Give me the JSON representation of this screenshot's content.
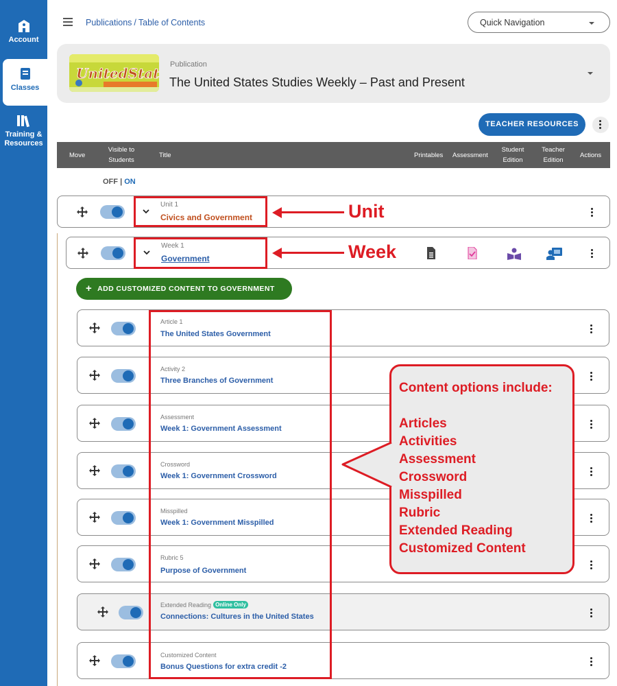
{
  "sidebar": {
    "items": [
      {
        "label": "Account"
      },
      {
        "label": "Classes"
      },
      {
        "label": "Training &",
        "label2": "Resources"
      }
    ]
  },
  "header": {
    "breadcrumb": {
      "root": "Publications",
      "separator": "/",
      "current": "Table of Contents"
    },
    "quick_nav": {
      "label": "Quick Navigation"
    }
  },
  "publication": {
    "label": "Publication",
    "title": "The United States Studies Weekly – Past and Present"
  },
  "teacher_resources_label": "TEACHER RESOURCES",
  "table_header": {
    "move": "Move",
    "visible1": "Visible to",
    "visible2": "Students",
    "title": "Title",
    "printables": "Printables",
    "assessment": "Assessment",
    "student1": "Student",
    "student2": "Edition",
    "teacher1": "Teacher",
    "teacher2": "Edition",
    "actions": "Actions"
  },
  "visibility": {
    "off": "OFF",
    "sep": "|",
    "on": "ON"
  },
  "unit": {
    "label": "Unit 1",
    "title": "Civics and Government",
    "visible": true
  },
  "week": {
    "label": "Week 1",
    "title": "Government",
    "visible": true
  },
  "add_content": {
    "prefix": "ADD CUSTOMIZED CONTENT TO",
    "target": "GOVERNMENT"
  },
  "content_rows": [
    {
      "type": "Article 1",
      "title": "The United States Government",
      "visible": true
    },
    {
      "type": "Activity 2",
      "title": "Three Branches of Government",
      "visible": true
    },
    {
      "type": "Assessment",
      "title": "Week 1: Government Assessment",
      "visible": true
    },
    {
      "type": "Crossword",
      "title": "Week 1: Government Crossword",
      "visible": true
    },
    {
      "type": "Misspilled",
      "title": "Week 1: Government Misspilled",
      "visible": true
    },
    {
      "type": "Rubric 5",
      "title": "Purpose of Government",
      "visible": true
    },
    {
      "type": "Extended Reading",
      "badge": "Online Only",
      "title": "Connections: Cultures in the United States",
      "visible": true
    },
    {
      "type": "Customized Content",
      "title": "Bonus Questions for extra credit -2",
      "visible": true
    }
  ],
  "annotations": {
    "unit": "Unit",
    "week": "Week",
    "callout_title": "Content options include:",
    "callout_items": [
      "Articles",
      "Activities",
      "Assessment",
      "Crossword",
      "Misspilled",
      "Rubric",
      "Extended Reading",
      "Customized Content"
    ]
  },
  "colors": {
    "brand_blue": "#1f6bb6",
    "annotation_red": "#dd1c24",
    "add_green": "#2e7a21",
    "unit_title": "#c0501f",
    "link_blue": "#2c5ea8"
  }
}
